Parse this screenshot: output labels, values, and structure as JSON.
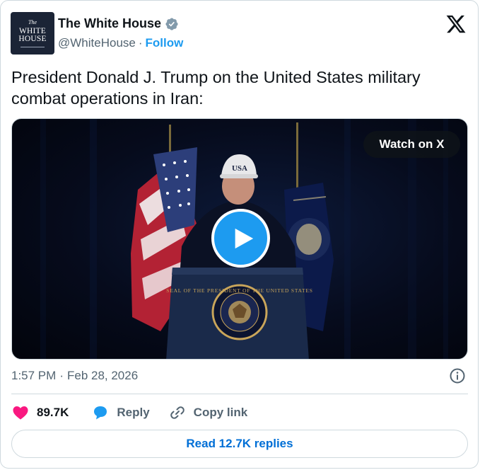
{
  "author": {
    "avatar_lines": [
      "The",
      "WHITE",
      "HOUSE"
    ],
    "display_name": "The White House",
    "handle": "@WhiteHouse",
    "separator": "·",
    "follow_label": "Follow",
    "badge": "gray-verified-badge-icon"
  },
  "tweet": {
    "text": "President Donald J. Trump on the United States military combat operations in Iran:"
  },
  "media": {
    "watch_label": "Watch on X",
    "cap_text": "USA",
    "seal_text": "SEAL OF THE PRESIDENT OF THE UNITED STATES",
    "play_icon": "play-icon"
  },
  "meta": {
    "time": "1:57 PM",
    "separator": "·",
    "date": "Feb 28, 2026"
  },
  "actions": {
    "likes_count": "89.7K",
    "reply_label": "Reply",
    "copy_link_label": "Copy link"
  },
  "replies_button": "Read 12.7K replies",
  "colors": {
    "accent": "#1d9bf0",
    "like": "#f91880",
    "link_blue": "#006fd6",
    "muted": "#536471",
    "border": "#cfd9de"
  }
}
